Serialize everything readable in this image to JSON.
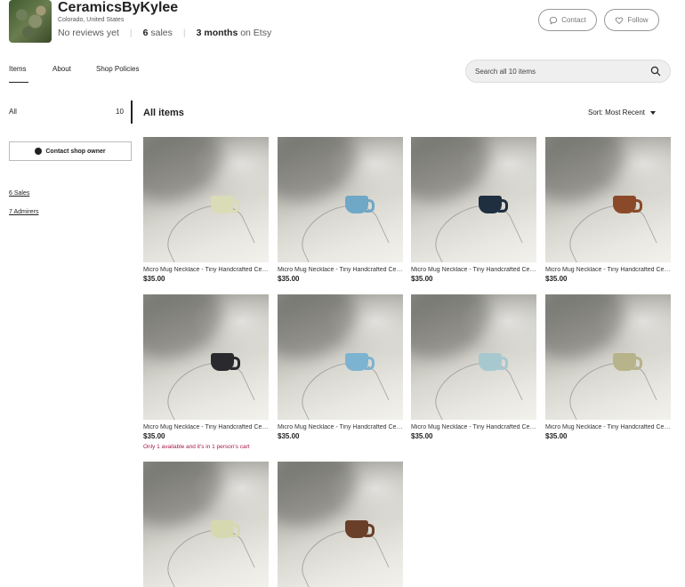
{
  "shop": {
    "name": "CeramicsByKylee",
    "location": "Colorado, United States",
    "reviews": "No reviews yet",
    "sales_count": "6",
    "sales_word": "sales",
    "tenure": "3 months",
    "tenure_suffix": "on Etsy"
  },
  "header_buttons": {
    "contact": "Contact",
    "follow": "Follow"
  },
  "tabs": [
    "Items",
    "About",
    "Shop Policies"
  ],
  "search": {
    "placeholder": "Search all 10 items"
  },
  "sidebar": {
    "all_label": "All",
    "all_count": "10",
    "contact_owner": "Contact shop owner",
    "sales_link": "6 Sales",
    "admirers_link": "7 Admirers"
  },
  "main": {
    "title": "All items",
    "sort_label": "Sort: Most Recent"
  },
  "listings": [
    {
      "title": "Micro Mug Necklace - Tiny Handcrafted Ceramic",
      "price": "$35.00",
      "note": "",
      "mug_color": "#d9dcb6"
    },
    {
      "title": "Micro Mug Necklace - Tiny Handcrafted Ceramic",
      "price": "$35.00",
      "note": "",
      "mug_color": "#6fa7c6"
    },
    {
      "title": "Micro Mug Necklace - Tiny Handcrafted Ceramic",
      "price": "$35.00",
      "note": "",
      "mug_color": "#1f2f3f"
    },
    {
      "title": "Micro Mug Necklace - Tiny Handcrafted Ceramic",
      "price": "$35.00",
      "note": "",
      "mug_color": "#8a4a2a"
    },
    {
      "title": "Micro Mug Necklace - Tiny Handcrafted Ceramic",
      "price": "$35.00",
      "note": "Only 1 available and it's in 1 person's cart",
      "mug_color": "#2a2a2e"
    },
    {
      "title": "Micro Mug Necklace - Tiny Handcrafted Ceramic",
      "price": "$35.00",
      "note": "",
      "mug_color": "#7cb3d0"
    },
    {
      "title": "Micro Mug Necklace - Tiny Handcrafted Ceramic",
      "price": "$35.00",
      "note": "",
      "mug_color": "#a8c8d0"
    },
    {
      "title": "Micro Mug Necklace - Tiny Handcrafted Ceramic",
      "price": "$35.00",
      "note": "",
      "mug_color": "#b7b38a"
    },
    {
      "title": "",
      "price": "",
      "note": "",
      "mug_color": "#d6d9b0"
    },
    {
      "title": "",
      "price": "",
      "note": "",
      "mug_color": "#6a3f2a"
    }
  ]
}
